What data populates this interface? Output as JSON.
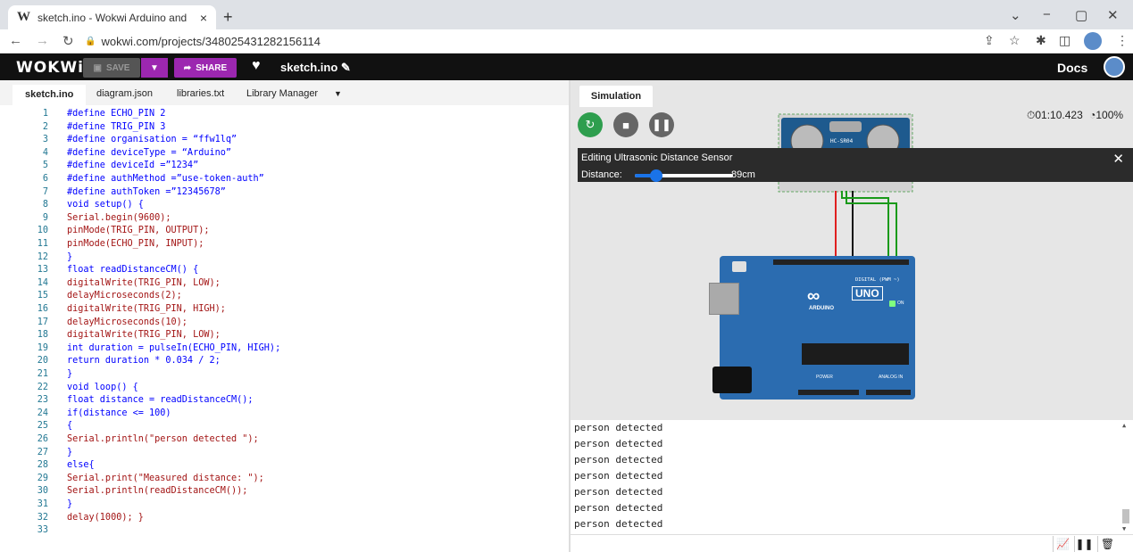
{
  "browser": {
    "tab_title": "sketch.ino - Wokwi Arduino and",
    "tab_favicon": "W",
    "tab_close": "×",
    "new_tab": "+",
    "url": "wokwi.com/projects/348025431282156114"
  },
  "wokwi": {
    "logo": "WOKWi",
    "save_label": "SAVE",
    "share_label": "SHARE",
    "file_name": "sketch.ino",
    "docs_label": "Docs"
  },
  "editor": {
    "tabs": [
      "sketch.ino",
      "diagram.json",
      "libraries.txt",
      "Library Manager"
    ],
    "lines": [
      {
        "n": "1",
        "t": "#define ECHO_PIN 2",
        "k": "kw"
      },
      {
        "n": "2",
        "t": "#define TRIG_PIN 3",
        "k": "kw"
      },
      {
        "n": "3",
        "t": "#define organisation = “ffw1lq”",
        "k": "kw"
      },
      {
        "n": "4",
        "t": "#define deviceType = “Arduino”",
        "k": "kw"
      },
      {
        "n": "5",
        "t": "#define deviceId =”1234”",
        "k": "kw"
      },
      {
        "n": "6",
        "t": "#define authMethod =”use-token-auth”",
        "k": "kw"
      },
      {
        "n": "7",
        "t": "#define authToken =”12345678”",
        "k": "kw"
      },
      {
        "n": "8",
        "t": "void setup() {",
        "k": "kw"
      },
      {
        "n": "9",
        "t": "Serial.begin(9600);",
        "k": "fn"
      },
      {
        "n": "10",
        "t": "pinMode(TRIG_PIN, OUTPUT);",
        "k": "fn"
      },
      {
        "n": "11",
        "t": "pinMode(ECHO_PIN, INPUT);",
        "k": "fn"
      },
      {
        "n": "12",
        "t": "}",
        "k": "kw"
      },
      {
        "n": "13",
        "t": "float readDistanceCM() {",
        "k": "kw"
      },
      {
        "n": "14",
        "t": "digitalWrite(TRIG_PIN, LOW);",
        "k": "fn"
      },
      {
        "n": "15",
        "t": "delayMicroseconds(2);",
        "k": "fn"
      },
      {
        "n": "16",
        "t": "digitalWrite(TRIG_PIN, HIGH);",
        "k": "fn"
      },
      {
        "n": "17",
        "t": "delayMicroseconds(10);",
        "k": "fn"
      },
      {
        "n": "18",
        "t": "digitalWrite(TRIG_PIN, LOW);",
        "k": "fn"
      },
      {
        "n": "19",
        "t": "int duration = pulseIn(ECHO_PIN, HIGH);",
        "k": "kw"
      },
      {
        "n": "20",
        "t": "return duration * 0.034 / 2;",
        "k": "kw"
      },
      {
        "n": "21",
        "t": "}",
        "k": "kw"
      },
      {
        "n": "22",
        "t": "void loop() {",
        "k": "kw"
      },
      {
        "n": "23",
        "t": "float distance = readDistanceCM();",
        "k": "kw"
      },
      {
        "n": "24",
        "t": "if(distance <= 100)",
        "k": "kw"
      },
      {
        "n": "25",
        "t": "{",
        "k": "kw"
      },
      {
        "n": "26",
        "t": "Serial.println(\"person detected \");",
        "k": "fn"
      },
      {
        "n": "27",
        "t": "}",
        "k": "kw"
      },
      {
        "n": "28",
        "t": "else{",
        "k": "kw"
      },
      {
        "n": "29",
        "t": "Serial.print(\"Measured distance: \");",
        "k": "fn"
      },
      {
        "n": "30",
        "t": "Serial.println(readDistanceCM());",
        "k": "fn"
      },
      {
        "n": "31",
        "t": "}",
        "k": "kw"
      },
      {
        "n": "32",
        "t": "delay(1000); }",
        "k": "fn"
      },
      {
        "n": "33",
        "t": "",
        "k": "kw"
      }
    ]
  },
  "simulation": {
    "tab_label": "Simulation",
    "timer": "01:10.423",
    "speed": "100%",
    "overlay_title": "Editing Ultrasonic Distance Sensor",
    "distance_label": "Distance:",
    "distance_value": "89cm",
    "distance_fraction": 0.22,
    "sensor_label": "HC-SR04",
    "board_label": "UNO",
    "board_brand": "ARDUINO",
    "digital_label": "DIGITAL (PWM ~)",
    "analog_label": "ANALOG IN",
    "power_label": "POWER",
    "on_label": "ON"
  },
  "serial": {
    "lines": [
      "person detected",
      "person detected",
      "person detected",
      "person detected",
      "person detected",
      "person detected",
      "person detected"
    ]
  },
  "colors": {
    "accent": "#9c27b0",
    "restart": "#2e9e4e",
    "board": "#2b6cb0",
    "slider": "#1a73e8"
  }
}
